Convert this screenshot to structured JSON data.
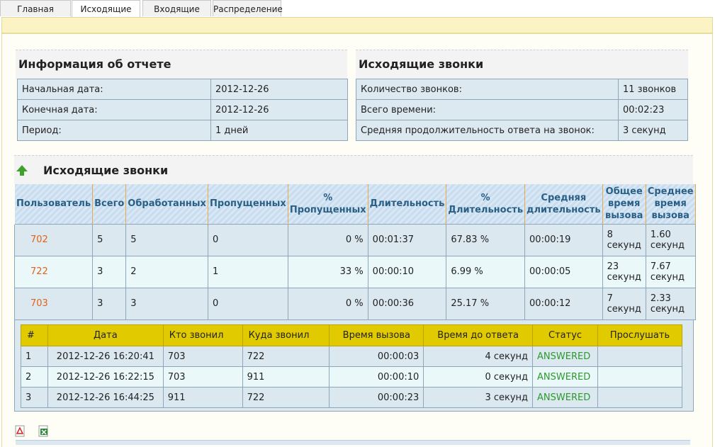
{
  "tabs": [
    {
      "label": "Главная",
      "active": false
    },
    {
      "label": "Исходящие",
      "active": true
    },
    {
      "label": "Входящие",
      "active": false
    },
    {
      "label": "Распределение",
      "active": false
    }
  ],
  "report_info": {
    "title": "Информация об отчете",
    "rows": [
      {
        "label": "Начальная дата:",
        "value": "2012-12-26"
      },
      {
        "label": "Конечная дата:",
        "value": "2012-12-26"
      },
      {
        "label": "Период:",
        "value": "1 дней"
      }
    ]
  },
  "outgoing_summary": {
    "title": "Исходящие звонки",
    "rows": [
      {
        "label": "Количество звонков:",
        "value": "11 звонков"
      },
      {
        "label": "Всего времени:",
        "value": "00:02:23"
      },
      {
        "label": "Средняя продолжительность ответа на звонок:",
        "value": "3 секунд"
      }
    ]
  },
  "stats": {
    "title": "Исходящие звонки",
    "columns": [
      "Пользователь",
      "Всего",
      "Обработанных",
      "Пропущенных",
      "% Пропущенных",
      "Длительность",
      "% Длительность",
      "Средняя длительность",
      "Общее время вызова",
      "Среднее время вызова"
    ],
    "rows": [
      {
        "user": "702",
        "total": "5",
        "handled": "5",
        "missed": "0",
        "missed_pct": "0 %",
        "duration": "00:01:37",
        "duration_pct": "67.83 %",
        "avg_duration": "00:00:19",
        "total_call_time": "8 секунд",
        "avg_call_time": "1.60 секунд"
      },
      {
        "user": "722",
        "total": "3",
        "handled": "2",
        "missed": "1",
        "missed_pct": "33 %",
        "duration": "00:00:10",
        "duration_pct": "6.99 %",
        "avg_duration": "00:00:05",
        "total_call_time": "23 секунд",
        "avg_call_time": "7.67 секунд"
      },
      {
        "user": "703",
        "total": "3",
        "handled": "3",
        "missed": "0",
        "missed_pct": "0 %",
        "duration": "00:00:36",
        "duration_pct": "25.17 %",
        "avg_duration": "00:00:12",
        "total_call_time": "7 секунд",
        "avg_call_time": "2.33 секунд"
      }
    ]
  },
  "details": {
    "columns": [
      "#",
      "Дата",
      "Кто звонил",
      "Куда звонил",
      "Время вызова",
      "Время до ответа",
      "Статус",
      "Прослушать"
    ],
    "rows": [
      {
        "n": "1",
        "date": "2012-12-26 16:20:41",
        "from": "703",
        "to": "722",
        "call_time": "00:00:03",
        "answer_time": "4 секунд",
        "status": "ANSWERED",
        "listen": ""
      },
      {
        "n": "2",
        "date": "2012-12-26 16:22:15",
        "from": "703",
        "to": "911",
        "call_time": "00:00:10",
        "answer_time": "0 секунд",
        "status": "ANSWERED",
        "listen": ""
      },
      {
        "n": "3",
        "date": "2012-12-26 16:44:25",
        "from": "911",
        "to": "722",
        "call_time": "00:00:23",
        "answer_time": "3 секунд",
        "status": "ANSWERED",
        "listen": ""
      }
    ]
  },
  "export_icons": [
    "pdf-icon",
    "excel-icon"
  ],
  "colors": {
    "accent_yellow": "#e1cb00",
    "user_link": "#e0621c",
    "status_answered": "#2b9a2b",
    "header_blue": "#2a5f86"
  }
}
